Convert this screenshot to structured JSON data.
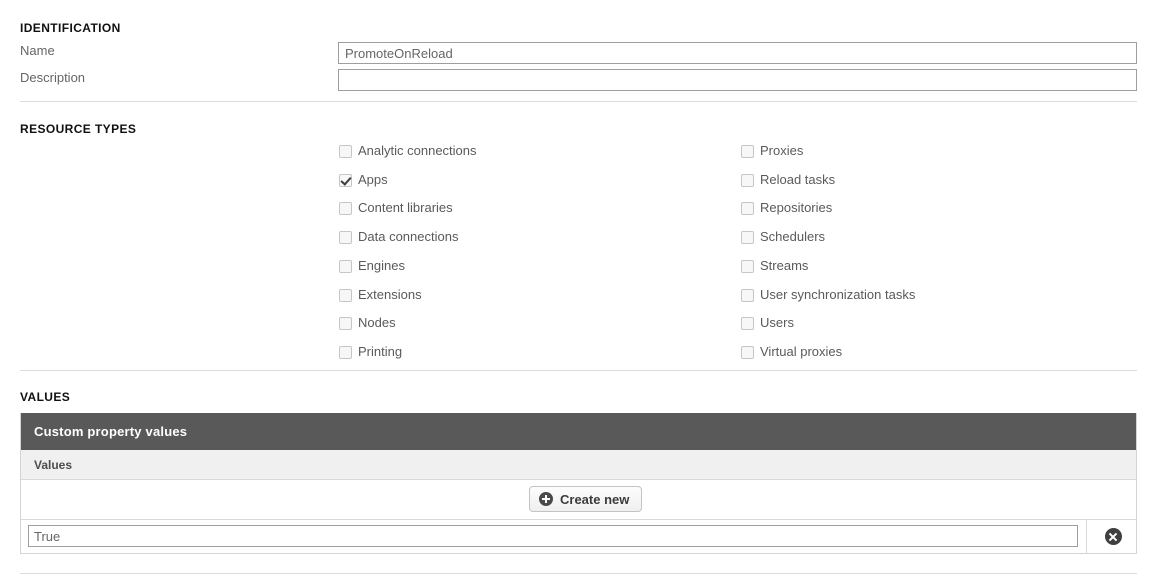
{
  "identification": {
    "section_label": "IDENTIFICATION",
    "name_label": "Name",
    "name_value": "PromoteOnReload",
    "description_label": "Description",
    "description_value": "",
    "description_placeholder": ""
  },
  "resource_types": {
    "section_label": "RESOURCE TYPES",
    "left_column": [
      {
        "label": "Analytic connections",
        "checked": false
      },
      {
        "label": "Apps",
        "checked": true
      },
      {
        "label": "Content libraries",
        "checked": false
      },
      {
        "label": "Data connections",
        "checked": false
      },
      {
        "label": "Engines",
        "checked": false
      },
      {
        "label": "Extensions",
        "checked": false
      },
      {
        "label": "Nodes",
        "checked": false
      },
      {
        "label": "Printing",
        "checked": false
      }
    ],
    "right_column": [
      {
        "label": "Proxies",
        "checked": false
      },
      {
        "label": "Reload tasks",
        "checked": false
      },
      {
        "label": "Repositories",
        "checked": false
      },
      {
        "label": "Schedulers",
        "checked": false
      },
      {
        "label": "Streams",
        "checked": false
      },
      {
        "label": "User synchronization tasks",
        "checked": false
      },
      {
        "label": "Users",
        "checked": false
      },
      {
        "label": "Virtual proxies",
        "checked": false
      }
    ]
  },
  "values": {
    "section_label": "VALUES",
    "table_title": "Custom property values",
    "column_header": "Values",
    "create_button_label": "Create new",
    "create_button_icon": "plus-circle-icon",
    "rows": [
      {
        "value": "True",
        "delete_icon": "delete-circle-icon"
      }
    ]
  },
  "colors": {
    "table_header_bg": "#595959",
    "table_subhead_bg": "#f0f0f0",
    "divider": "#dcdcdc",
    "label_text": "#666666",
    "input_border": "#9e9e9e"
  }
}
